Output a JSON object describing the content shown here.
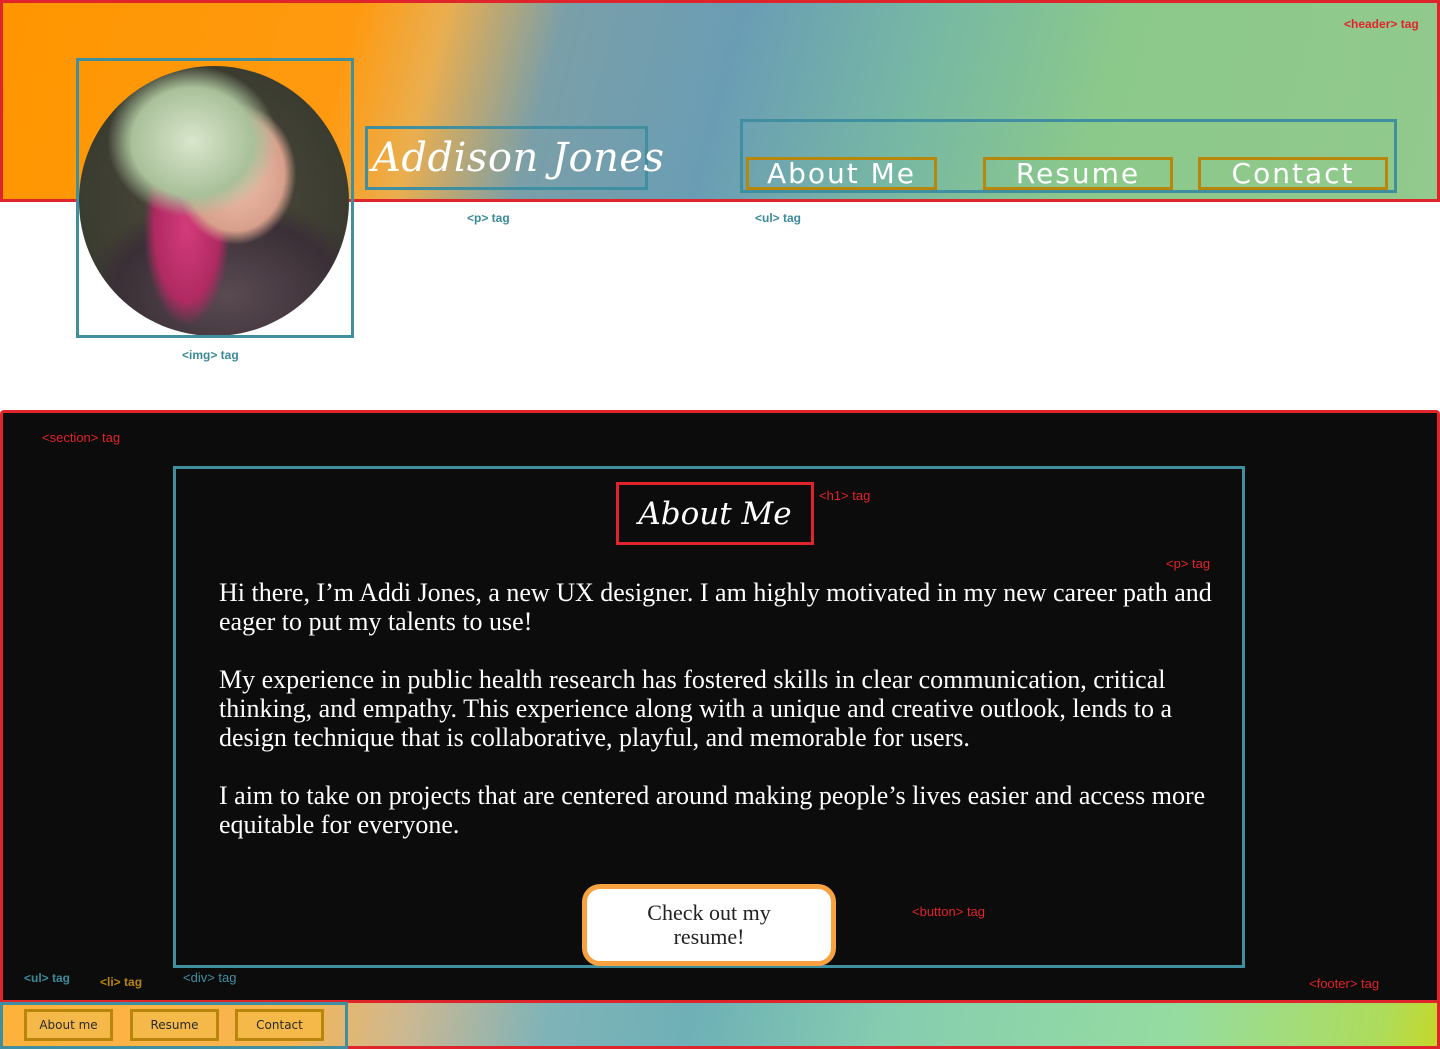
{
  "header": {
    "tag_label": "<header> tag",
    "site_name": "Addison Jones",
    "p_tag_label": "<p> tag",
    "ul_tag_label": "<ul> tag",
    "img_tag_label": "<img> tag",
    "avatar_icon": "profile-photo",
    "nav": [
      {
        "label": "About Me"
      },
      {
        "label": "Resume"
      },
      {
        "label": "Contact"
      }
    ]
  },
  "section": {
    "tag_label": "<section> tag",
    "h1_tag_label": "<h1> tag",
    "p_tag_label": "<p> tag",
    "div_tag_label": "<div> tag",
    "button_tag_label": "<button> tag",
    "title": "About Me",
    "paragraphs": [
      "Hi there, I’m Addi Jones, a new UX designer. I am highly motivated in my new career path and eager to put my talents to use!",
      "My experience in public health research has fostered skills in clear communication, critical thinking, and empathy. This experience along with a unique and creative outlook, lends to a design technique that is collaborative, playful, and memorable for users.",
      "I aim to take on projects that are centered around making people’s lives easier and access more equitable for everyone."
    ],
    "button_label": "Check out my resume!"
  },
  "footer": {
    "tag_label": "<footer> tag",
    "ul_tag_label": "<ul> tag",
    "li_tag_label": "<li> tag",
    "nav": [
      {
        "label": "About me"
      },
      {
        "label": "Resume"
      },
      {
        "label": "Contact"
      }
    ]
  },
  "colors": {
    "annotation_red": "#e0242b",
    "annotation_teal": "#3f8fa0",
    "annotation_gold": "#b8860b",
    "button_border": "#f8a140",
    "section_bg": "#0c0c0c"
  }
}
